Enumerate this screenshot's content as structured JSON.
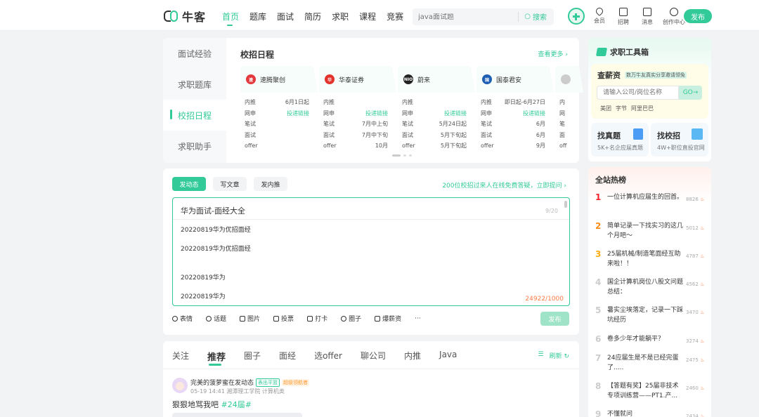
{
  "header": {
    "logo_text": "牛客",
    "nav": [
      "首页",
      "题库",
      "面试",
      "简历",
      "求职",
      "课程",
      "竞赛"
    ],
    "search_placeholder": "java面试题",
    "search_btn": "搜索",
    "icons": [
      {
        "name": "vip-icon",
        "label": "会员"
      },
      {
        "name": "job-icon",
        "label": "招聘"
      },
      {
        "name": "message-icon",
        "label": "消息"
      },
      {
        "name": "creator-icon",
        "label": "创作中心"
      }
    ],
    "publish": "发布"
  },
  "sidemenu": [
    "面试经验",
    "求职题库",
    "校招日程",
    "求职助手"
  ],
  "schedule": {
    "title": "校招日程",
    "more": "查看更多",
    "companies": [
      {
        "name": "速腾聚创",
        "color": "#e4393c",
        "abbr": "速",
        "rows": [
          [
            "内推",
            "6月1日起",
            false
          ],
          [
            "网申",
            "投递链接",
            true
          ],
          [
            "笔试",
            "",
            false
          ],
          [
            "面试",
            "",
            false
          ],
          [
            "offer",
            "",
            false
          ]
        ]
      },
      {
        "name": "华泰证券",
        "color": "#e2322b",
        "abbr": "华",
        "rows": [
          [
            "内推",
            "",
            false
          ],
          [
            "网申",
            "投递链接",
            true
          ],
          [
            "笔试",
            "7月中上旬",
            false
          ],
          [
            "面试",
            "7月中下旬",
            false
          ],
          [
            "offer",
            "10月",
            false
          ]
        ]
      },
      {
        "name": "蔚来",
        "color": "#222222",
        "abbr": "NIO",
        "rows": [
          [
            "内推",
            "",
            false
          ],
          [
            "网申",
            "投递链接",
            true
          ],
          [
            "笔试",
            "5月24日起",
            false
          ],
          [
            "面试",
            "5月下旬起",
            false
          ],
          [
            "offer",
            "5月下旬起",
            false
          ]
        ]
      },
      {
        "name": "国泰君安",
        "color": "#1e5fb4",
        "abbr": "国",
        "rows": [
          [
            "内推",
            "即日起-6月27日",
            false
          ],
          [
            "网申",
            "投递链接",
            true
          ],
          [
            "笔试",
            "6月",
            false
          ],
          [
            "面试",
            "6月",
            false
          ],
          [
            "offer",
            "9月",
            false
          ]
        ]
      },
      {
        "name": "",
        "color": "#cccccc",
        "abbr": "",
        "rows": [
          [
            "内",
            "",
            false
          ],
          [
            "网",
            "",
            false
          ],
          [
            "笔",
            "",
            false
          ],
          [
            "面",
            "",
            false
          ],
          [
            "off",
            "",
            false
          ]
        ]
      }
    ]
  },
  "composer": {
    "tabs": [
      "发动态",
      "写文章",
      "发内推"
    ],
    "hint": "200位校招过来人在线免费答疑，立即提问",
    "title_value": "华为面试-面经大全",
    "title_count": "9/20",
    "lines": [
      "20220819华为优招面经",
      "20220819华为优招面经",
      "20220819华为",
      "20220819华为"
    ],
    "total": "24922/1000",
    "tools": [
      "表情",
      "话题",
      "图片",
      "投票",
      "打卡",
      "圈子",
      "爆薪资",
      "···"
    ],
    "publish": "发布"
  },
  "feed": {
    "tabs": [
      "关注",
      "推荐",
      "圈子",
      "面经",
      "选offer",
      "聊公司",
      "内推",
      "Java"
    ],
    "refresh": "刷新",
    "post": {
      "user": "完美的菠萝蜜在发动态",
      "badge1": "表出平篮",
      "badge2": "超级领航者",
      "meta": "05-19 14:41  湘潭理工学院 计算机类",
      "text": "狠狠地骂我吧 ",
      "tag": "#24届#"
    }
  },
  "toolbox": {
    "title": "求职工具箱",
    "salary_title": "查薪资",
    "salary_sub": "数万牛友真实分享邀请领免",
    "salary_placeholder": "请输入公司/岗位名称",
    "salary_go": "GO→",
    "salary_tags": [
      "美团",
      "字节",
      "阿里巴巴"
    ],
    "card1_title": "找真题",
    "card1_sub": "5K+名企应届真题",
    "card2_title": "找校招",
    "card2_sub": "4W+职位直投官网"
  },
  "hot": {
    "title": "全站热榜",
    "items": [
      {
        "rank": "1",
        "text": "一位计算机应届生的回首。",
        "heat": "8826"
      },
      {
        "rank": "2",
        "text": "简单记录一下找实习的这几个月吧～",
        "heat": "5012"
      },
      {
        "rank": "3",
        "text": "25届机械/制造笔面经互助来啦！！",
        "heat": "4787"
      },
      {
        "rank": "4",
        "text": "国企计算机岗位八股文问题总结：",
        "heat": "4562"
      },
      {
        "rank": "5",
        "text": "暑实尘埃落定，记录一下踩坑经历",
        "heat": "3470"
      },
      {
        "rank": "6",
        "text": "卷多少年才能躺平？",
        "heat": "3274"
      },
      {
        "rank": "7",
        "text": "24应届生是不是已经完蛋了.....",
        "heat": "2475"
      },
      {
        "rank": "8",
        "text": "【答题有奖】25届非技术专项训练营——PT1.产...",
        "heat": "2460"
      },
      {
        "rank": "9",
        "text": "不懂就问",
        "heat": "2434"
      }
    ]
  }
}
